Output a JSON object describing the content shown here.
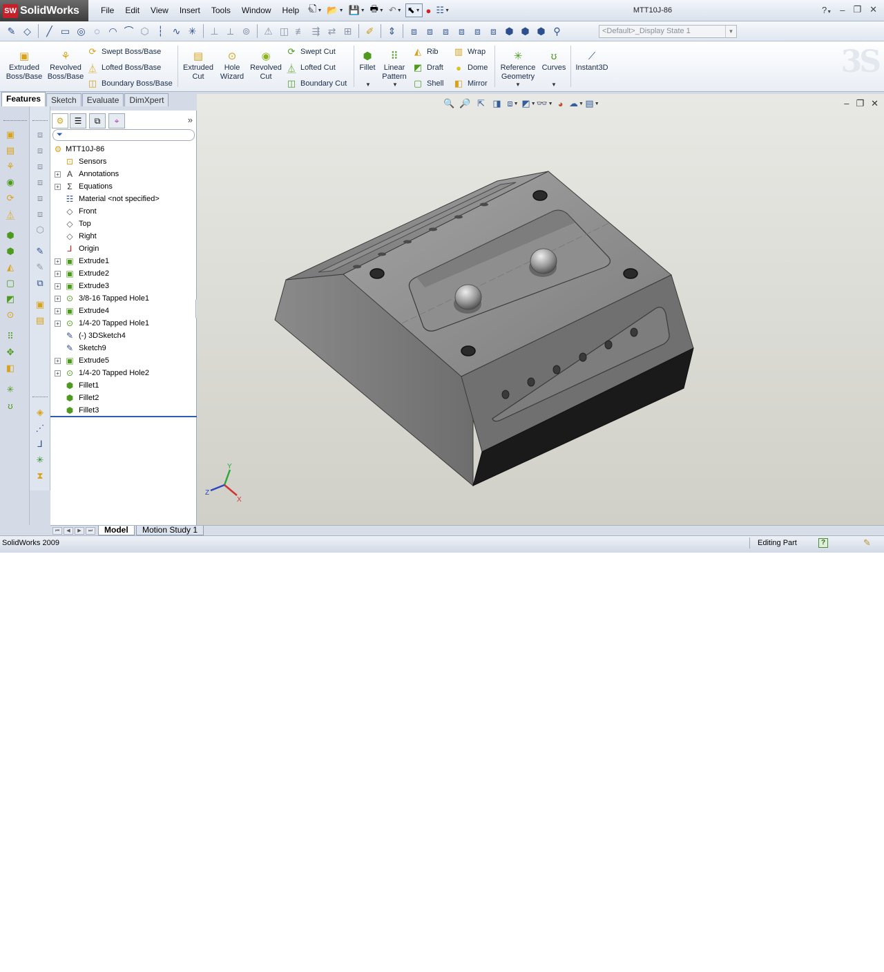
{
  "app": {
    "brand": "SolidWorks",
    "brand_mark": "SW",
    "document_title": "MTT10J-86",
    "menus": [
      "File",
      "Edit",
      "View",
      "Insert",
      "Tools",
      "Window",
      "Help"
    ]
  },
  "display_state": "<Default>_Display State 1",
  "command_manager": {
    "big_buttons": [
      {
        "label1": "Extruded",
        "label2": "Boss/Base"
      },
      {
        "label1": "Revolved",
        "label2": "Boss/Base"
      },
      {
        "label1": "Extruded",
        "label2": "Cut"
      },
      {
        "label1": "Hole",
        "label2": "Wizard"
      },
      {
        "label1": "Revolved",
        "label2": "Cut"
      },
      {
        "label1": "Fillet",
        "label2": ""
      },
      {
        "label1": "Linear",
        "label2": "Pattern"
      },
      {
        "label1": "Reference",
        "label2": "Geometry"
      },
      {
        "label1": "Curves",
        "label2": ""
      },
      {
        "label1": "Instant3D",
        "label2": ""
      }
    ],
    "small_buttons": [
      "Swept Boss/Base",
      "Lofted Boss/Base",
      "Boundary Boss/Base",
      "Swept Cut",
      "Lofted Cut",
      "Boundary Cut",
      "Rib",
      "Draft",
      "Shell",
      "Wrap",
      "Dome",
      "Mirror"
    ]
  },
  "command_tabs": [
    "Features",
    "Sketch",
    "Evaluate",
    "DimXpert"
  ],
  "feature_tree": {
    "root": "MTT10J-86",
    "items": [
      {
        "label": "Sensors",
        "expandable": false
      },
      {
        "label": "Annotations",
        "expandable": true
      },
      {
        "label": "Equations",
        "expandable": true
      },
      {
        "label": "Material <not specified>",
        "expandable": false
      },
      {
        "label": "Front",
        "expandable": false
      },
      {
        "label": "Top",
        "expandable": false
      },
      {
        "label": "Right",
        "expandable": false
      },
      {
        "label": "Origin",
        "expandable": false
      },
      {
        "label": "Extrude1",
        "expandable": true
      },
      {
        "label": "Extrude2",
        "expandable": true
      },
      {
        "label": "Extrude3",
        "expandable": true
      },
      {
        "label": "3/8-16 Tapped Hole1",
        "expandable": true
      },
      {
        "label": "Extrude4",
        "expandable": true
      },
      {
        "label": "1/4-20 Tapped Hole1",
        "expandable": true
      },
      {
        "label": "(-) 3DSketch4",
        "expandable": false
      },
      {
        "label": "Sketch9",
        "expandable": false
      },
      {
        "label": "Extrude5",
        "expandable": true
      },
      {
        "label": "1/4-20 Tapped Hole2",
        "expandable": true
      },
      {
        "label": "Fillet1",
        "expandable": false
      },
      {
        "label": "Fillet2",
        "expandable": false
      },
      {
        "label": "Fillet3",
        "expandable": false
      }
    ]
  },
  "model_tabs": [
    "Model",
    "Motion Study 1"
  ],
  "status": {
    "left": "SolidWorks 2009",
    "mode": "Editing Part",
    "help": "?"
  },
  "triad": {
    "x": "X",
    "y": "Y",
    "z": "Z"
  }
}
